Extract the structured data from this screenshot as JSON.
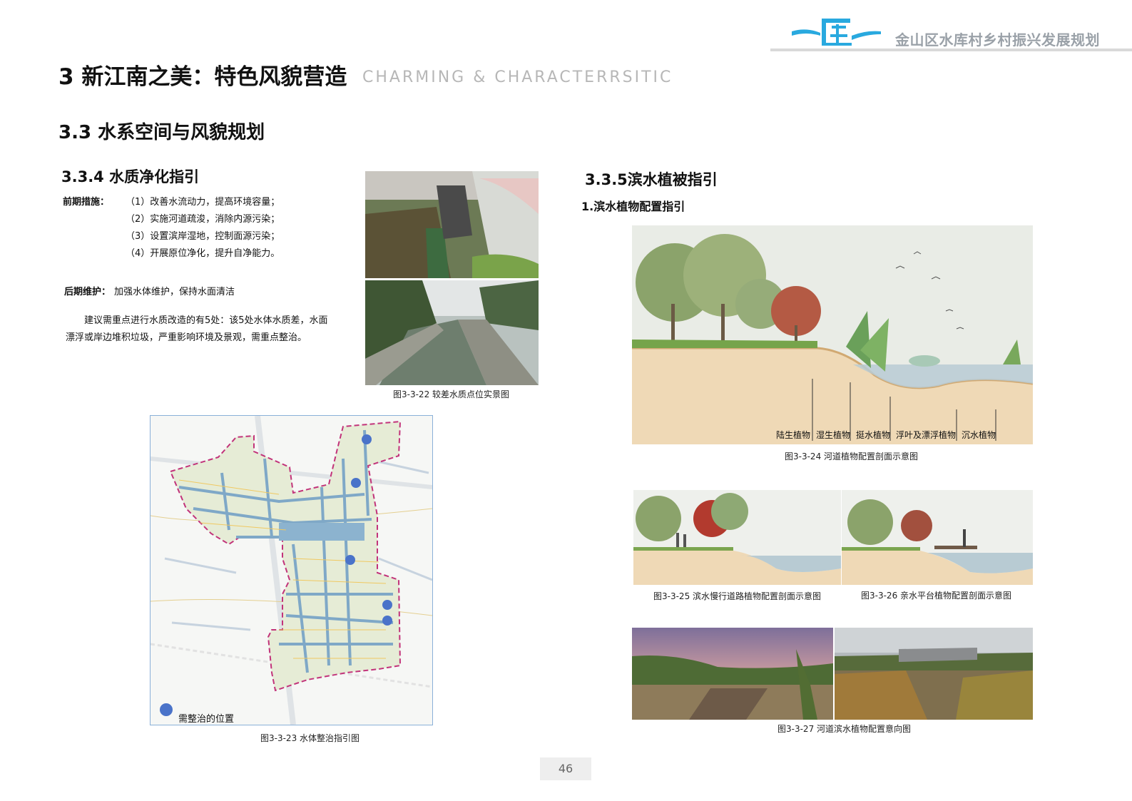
{
  "header": {
    "project_title": "金山区水库村乡村振兴发展规划",
    "accent_color": "#29a9df"
  },
  "page": {
    "title": "3 新江南之美：特色风貌营造",
    "subtitle": "CHARMING & CHARACTERRSITIC",
    "section": "3.3 水系空间与风貌规划",
    "page_number": "46"
  },
  "left": {
    "heading": "3.3.4 水质净化指引",
    "early_label": "前期措施",
    "early_items": [
      "（1）改善水流动力，提高环境容量；",
      "（2）实施河道疏浚，消除内源污染；",
      "（3）设置滨岸湿地，控制面源污染；",
      "（4）开展原位净化，提升自净能力。"
    ],
    "late_label": "后期维护",
    "late_text": "加强水体维护，保持水面清洁",
    "paragraph": "建议需重点进行水质改造的有5处：该5处水体水质差，水面漂浮或岸边堆积垃圾，严重影响环境及景观，需重点整治。",
    "photo_caption": "图3-3-22 较差水质点位实景图",
    "map_caption": "图3-3-23 水体整治指引图",
    "map_legend": "需整治的位置",
    "marker_color": "#4a73c9",
    "boundary_color": "#c2337a"
  },
  "right": {
    "heading": "3.3.5滨水植被指引",
    "subheading": "1.滨水植物配置指引",
    "section_labels": [
      "陆生植物",
      "湿生植物",
      "挺水植物",
      "浮叶及漂浮植物",
      "沉水植物"
    ],
    "cap_24": "图3-3-24 河道植物配置剖面示意图",
    "cap_25": "图3-3-25 滨水慢行道路植物配置剖面示意图",
    "cap_26": "图3-3-26 亲水平台植物配置剖面示意图",
    "cap_27": "图3-3-27 河道滨水植物配置意向图"
  }
}
